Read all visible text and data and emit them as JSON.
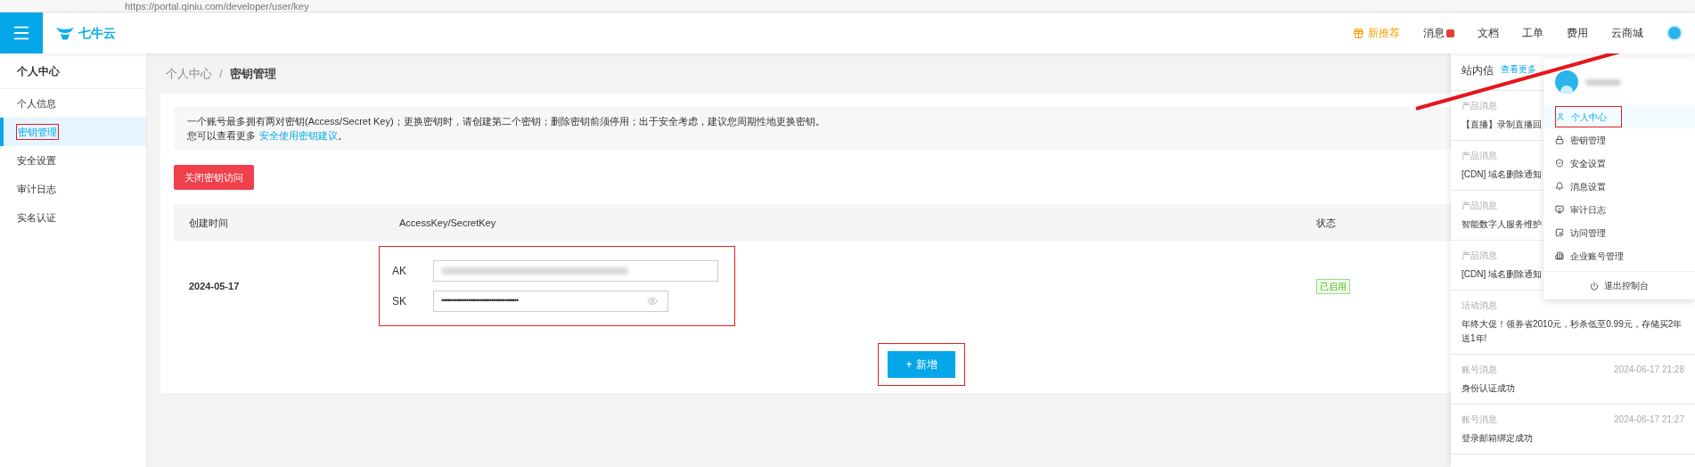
{
  "browser": {
    "url": "https://portal.qiniu.com/developer/user/key"
  },
  "topbar": {
    "logo": "七牛云",
    "nav": [
      {
        "label": "新推荐",
        "kind": "promo"
      },
      {
        "label": "消息",
        "kind": "badge"
      },
      {
        "label": "文档",
        "kind": "plain"
      },
      {
        "label": "工单",
        "kind": "plain"
      },
      {
        "label": "费用",
        "kind": "plain"
      },
      {
        "label": "云商城",
        "kind": "plain"
      }
    ]
  },
  "sidebar": {
    "title": "个人中心",
    "items": [
      {
        "label": "个人信息",
        "selected": false
      },
      {
        "label": "密钥管理",
        "selected": true
      },
      {
        "label": "安全设置",
        "selected": false
      },
      {
        "label": "审计日志",
        "selected": false
      },
      {
        "label": "实名认证",
        "selected": false
      }
    ]
  },
  "breadcrumb": {
    "parent": "个人中心",
    "separator": "/",
    "current": "密钥管理"
  },
  "notice": {
    "line1": "一个账号最多拥有两对密钥(Access/Secret Key)；更换密钥时，请创建第二个密钥；删除密钥前须停用；出于安全考虑，建议您周期性地更换密钥。",
    "prefix": "您可以查看更多",
    "link": "安全使用密钥建议",
    "suffix": "。"
  },
  "close_button": "关闭密钥访问",
  "table": {
    "columns": [
      "创建时间",
      "AccessKey/SecretKey",
      "状态"
    ],
    "rows": [
      {
        "created": "2024-05-17",
        "ak_label": "AK",
        "sk_label": "SK",
        "sk_value": "••••••••••••••••••••••••••••••••••••••••",
        "status": "已启用",
        "enabled": true
      }
    ]
  },
  "add_button": {
    "icon": "+",
    "label": "新增"
  },
  "messages_panel": {
    "title": "站内信",
    "more": "查看更多",
    "messages": [
      {
        "category": "产品消息",
        "text": "【直播】录制直播回"
      },
      {
        "category": "产品消息",
        "text": "[CDN] 域名删除通知"
      },
      {
        "category": "产品消息",
        "text": "智能数字人服务维护"
      },
      {
        "category": "产品消息",
        "text": "[CDN] 域名删除通知"
      },
      {
        "category": "活动消息",
        "text": "年终大促！领券省2010元，秒杀低至0.99元，存储买2年送1年!"
      },
      {
        "category": "账号消息",
        "time": "2024-06-17 21:28",
        "text": "身份认证成功"
      },
      {
        "category": "账号消息",
        "time": "2024-06-17 21:27",
        "text": "登录邮箱绑定成功"
      }
    ]
  },
  "user_menu": {
    "items": [
      {
        "label": "个人中心",
        "selected": true
      },
      {
        "label": "密钥管理",
        "selected": false
      },
      {
        "label": "安全设置",
        "selected": false
      },
      {
        "label": "消息设置",
        "selected": false
      },
      {
        "label": "审计日志",
        "selected": false
      },
      {
        "label": "访问管理",
        "selected": false
      },
      {
        "label": "企业账号管理",
        "selected": false
      }
    ],
    "logout": "退出控制台"
  }
}
